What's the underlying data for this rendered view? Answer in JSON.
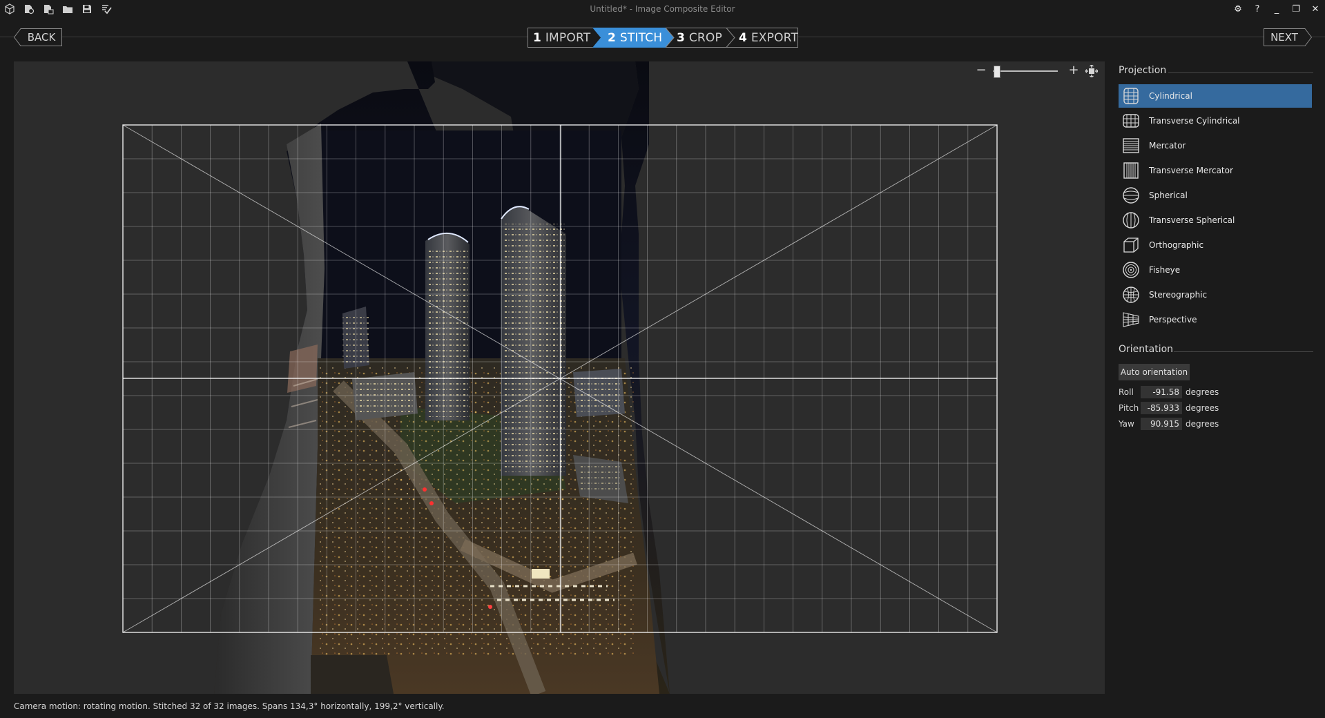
{
  "window": {
    "title": "Untitled* - Image Composite Editor",
    "toolbar_icons": [
      "app-logo-icon",
      "new-panorama-icon",
      "new-video-panorama-icon",
      "open-folder-icon",
      "save-icon",
      "export-check-icon"
    ],
    "settings_glyph": "⚙",
    "help_glyph": "?",
    "minimize_glyph": "_",
    "restore_glyph": "❐",
    "close_glyph": "✕"
  },
  "nav": {
    "back_label": "BACK",
    "next_label": "NEXT",
    "steps": [
      {
        "num": "1",
        "label": "IMPORT",
        "active": false
      },
      {
        "num": "2",
        "label": "STITCH",
        "active": true
      },
      {
        "num": "3",
        "label": "CROP",
        "active": false
      },
      {
        "num": "4",
        "label": "EXPORT",
        "active": false
      }
    ]
  },
  "zoom": {
    "minus_glyph": "−",
    "plus_glyph": "+",
    "level": 0.05
  },
  "panel": {
    "projection_title": "Projection",
    "projections": [
      {
        "name": "Cylindrical",
        "icon": "cylindrical-icon",
        "active": true
      },
      {
        "name": "Transverse Cylindrical",
        "icon": "transverse-cylindrical-icon",
        "active": false
      },
      {
        "name": "Mercator",
        "icon": "mercator-icon",
        "active": false
      },
      {
        "name": "Transverse Mercator",
        "icon": "transverse-mercator-icon",
        "active": false
      },
      {
        "name": "Spherical",
        "icon": "spherical-icon",
        "active": false
      },
      {
        "name": "Transverse Spherical",
        "icon": "transverse-spherical-icon",
        "active": false
      },
      {
        "name": "Orthographic",
        "icon": "orthographic-icon",
        "active": false
      },
      {
        "name": "Fisheye",
        "icon": "fisheye-icon",
        "active": false
      },
      {
        "name": "Stereographic",
        "icon": "stereographic-icon",
        "active": false
      },
      {
        "name": "Perspective",
        "icon": "perspective-icon",
        "active": false
      }
    ],
    "orientation_title": "Orientation",
    "auto_orientation_label": "Auto orientation",
    "roll": {
      "label": "Roll",
      "value": "-91.58",
      "unit": "degrees"
    },
    "pitch": {
      "label": "Pitch",
      "value": "-85.933",
      "unit": "degrees"
    },
    "yaw": {
      "label": "Yaw",
      "value": "90.915",
      "unit": "degrees"
    }
  },
  "status": {
    "text": "Camera motion: rotating motion. Stitched 32 of 32 images. Spans 134,3° horizontally, 199,2° vertically."
  },
  "colors": {
    "accent": "#3a8fd9",
    "selected": "#356a9e",
    "background": "#1b1b1b",
    "canvas": "#2c2c2c"
  }
}
